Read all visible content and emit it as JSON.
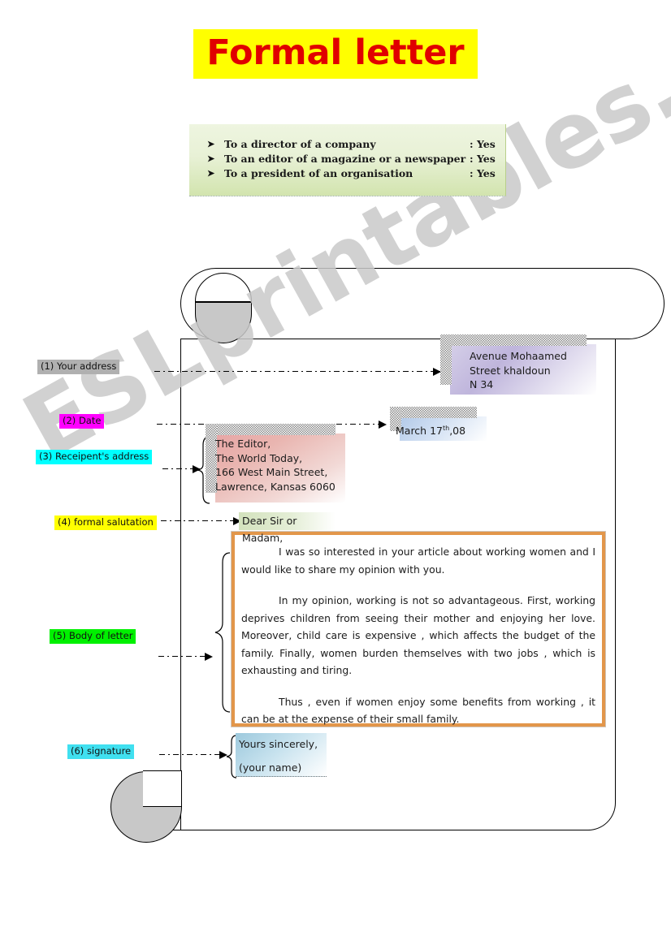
{
  "title": "Formal  letter",
  "colors": {
    "title_text": "#e00000",
    "title_highlight": "#ffff00",
    "body_border": "#e2964a",
    "label_1": "#b0b0b0",
    "label_2": "#ff00ff",
    "label_3": "#00ffff",
    "label_4": "#ffff00",
    "label_5": "#00f000",
    "label_6": "#40e0f0"
  },
  "watermark": "ESLprintables.com",
  "infobox": {
    "bullet_glyph": "➤",
    "items": [
      {
        "text": "To a director of a company",
        "answer": ": Yes"
      },
      {
        "text": " To an editor of a magazine or a newspaper",
        "answer": ": Yes"
      },
      {
        "text": "To a president of an organisation",
        "answer": ": Yes"
      }
    ]
  },
  "labels": {
    "l1": "(1)  Your address",
    "l2": "(2)  Date",
    "l3": "(3) Receipent's  address",
    "l4": "(4) formal salutation",
    "l5": "(5) Body of letter",
    "l6": "(6) signature"
  },
  "letter": {
    "sender_address": {
      "line1": "Avenue Mohaamed",
      "line2": "Street khaldoun",
      "line3": "N 34"
    },
    "date": {
      "month_day": "March 17",
      "ordinal": "th",
      "year": ",08"
    },
    "recipient_address": {
      "line1": "The Editor,",
      "line2": "The World Today,",
      "line3": "166 West Main Street,",
      "line4": "Lawrence, Kansas 6060"
    },
    "salutation": "Dear Sir or Madam,",
    "body": {
      "p1": "I was so interested in your article about  working women  and I would like to share my opinion with you.",
      "p2": "In my opinion,  working is not so advantageous. First,  working deprives   children from  seeing   their   mother and enjoying her love. Moreover,  child  care  is  expensive ,  which affects the budget of the family. Finally,  women  burden   themselves with two jobs ,  which is exhausting and tiring.",
      "p3": "Thus ,  even if   women enjoy some benefits   from  working , it can be  at the  expense of their small family."
    },
    "signature": {
      "closing": "Yours sincerely,",
      "name_placeholder": "(your name)"
    }
  }
}
